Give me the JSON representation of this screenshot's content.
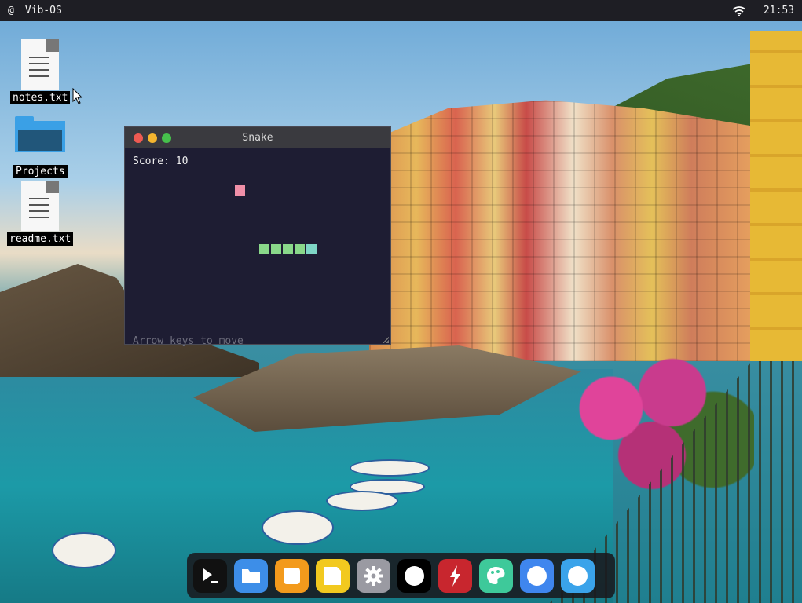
{
  "topbar": {
    "menu_symbol": "@",
    "os_name": "Vib-OS",
    "time": "21:53",
    "wifi_icon": "wifi-icon"
  },
  "desktop_icons": [
    {
      "label": "notes.txt",
      "icon": "text-file-icon"
    },
    {
      "label": "Projects",
      "icon": "folder-icon"
    },
    {
      "label": "readme.txt",
      "icon": "text-file-icon"
    }
  ],
  "window": {
    "title": "Snake",
    "score_text": "Score: 10",
    "hint_text": "Arrow keys to move",
    "colors": {
      "food": "#f08fa8",
      "body": "#8ad88a",
      "head": "#7ed6c6",
      "background": "#1e1d33"
    }
  },
  "dock": {
    "apps": [
      {
        "icon": "terminal-icon",
        "color": "#111111"
      },
      {
        "icon": "folder-icon",
        "color": "#3d8ee8"
      },
      {
        "icon": "orange-app-icon",
        "color": "#f39a1c"
      },
      {
        "icon": "notes-icon",
        "color": "#f2c91f"
      },
      {
        "icon": "settings-gear-icon",
        "color": "#9a9aa2"
      },
      {
        "icon": "circle-app-icon",
        "color": "#000000"
      },
      {
        "icon": "lightning-icon",
        "color": "#c8262e"
      },
      {
        "icon": "paint-palette-icon",
        "color": "#3ec99a"
      },
      {
        "icon": "circle-app-icon",
        "color": "#3f86ee"
      },
      {
        "icon": "circle-app-icon",
        "color": "#3aa3ea"
      }
    ]
  }
}
